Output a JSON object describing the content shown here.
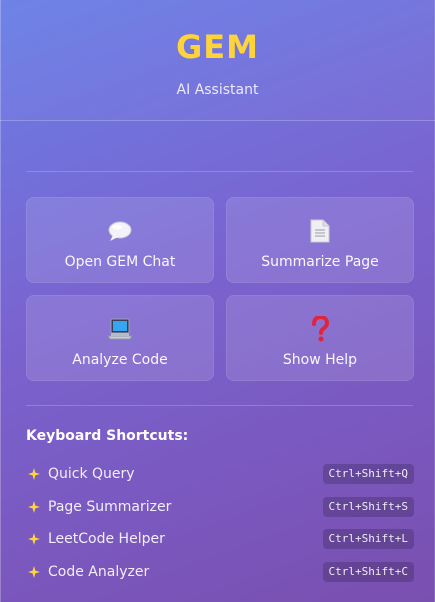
{
  "header": {
    "title": "GEM",
    "subtitle": "AI Assistant"
  },
  "actions": [
    {
      "label": "Open GEM Chat",
      "icon": "speech-bubble-icon"
    },
    {
      "label": "Summarize Page",
      "icon": "document-icon"
    },
    {
      "label": "Analyze Code",
      "icon": "laptop-icon"
    },
    {
      "label": "Show Help",
      "icon": "question-mark-icon"
    }
  ],
  "shortcuts": {
    "title": "Keyboard Shortcuts:",
    "items": [
      {
        "label": "Quick Query",
        "keys": "Ctrl+Shift+Q"
      },
      {
        "label": "Page Summarizer",
        "keys": "Ctrl+Shift+S"
      },
      {
        "label": "LeetCode Helper",
        "keys": "Ctrl+Shift+L"
      },
      {
        "label": "Code Analyzer",
        "keys": "Ctrl+Shift+C"
      }
    ]
  },
  "colors": {
    "accent": "#ffd43b",
    "bg_start": "#6a7fe6",
    "bg_end": "#7a4fb0"
  }
}
